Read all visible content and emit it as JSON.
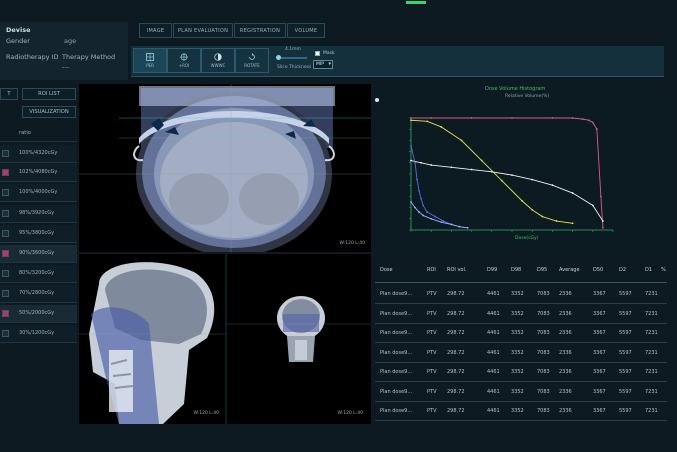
{
  "patient_info": {
    "device_label": "Devise",
    "gender_label": "Gender",
    "age_label": "age",
    "rt_id_label": "Radiotherapy ID",
    "therapy_label": "Therapy Method",
    "therapy_value": "---"
  },
  "tabs": [
    "IMAGE",
    "PLAN EVALUATION",
    "REGISTRATION",
    "VOLUME"
  ],
  "toolbar": {
    "tools": [
      "PER",
      "+ROI",
      "WWWC",
      "ROTATE"
    ],
    "slider_label": "4.1mm",
    "slice_thickness_label": "Slice Thickness",
    "checkbox_label": "Mask",
    "dropdown_value": "MIP"
  },
  "left_panel": {
    "btn_a": "T",
    "btn_roi_list": "ROI LIST",
    "btn_visualization": "VISUALIZATION",
    "header": "ratio",
    "items": [
      {
        "label": "100%/4320cGy",
        "color": "#1a2e38"
      },
      {
        "label": "102%/4080cGy",
        "color": "#c2306a"
      },
      {
        "label": "100%/4000cGy",
        "color": "#1a2e38"
      },
      {
        "label": "98%/3920cGy",
        "color": "#1a2e38"
      },
      {
        "label": "95%/3800cGy",
        "color": "#1a2e38"
      },
      {
        "label": "90%/3600cGy",
        "color": "#c2306a"
      },
      {
        "label": "80%/3200cGy",
        "color": "#1a2e38"
      },
      {
        "label": "70%/2800cGy",
        "color": "#1a2e38"
      },
      {
        "label": "50%/2000cGy",
        "color": "#c2306a"
      },
      {
        "label": "30%/1200cGy",
        "color": "#1a2e38"
      }
    ]
  },
  "views": {
    "axial_wl": "W:120 L:40",
    "sagittal_wl": "W:120 L:40",
    "coronal_wl": "W:120 L:40"
  },
  "chart_data": {
    "type": "line",
    "title": "Dose Volume Histogram",
    "ylabel": "Relative Volume(%)",
    "xlabel": "Dose(cGy)",
    "xlim": [
      0,
      100
    ],
    "ylim": [
      0,
      100
    ],
    "series": [
      {
        "color": "#e05a8a",
        "x": [
          0,
          10,
          30,
          50,
          70,
          80,
          85,
          88,
          90,
          92,
          94,
          95
        ],
        "y": [
          100,
          100,
          100,
          100,
          100,
          100,
          99,
          98,
          96,
          90,
          30,
          2
        ]
      },
      {
        "color": "#e8e050",
        "x": [
          0,
          8,
          15,
          25,
          35,
          45,
          55,
          60,
          65,
          72,
          80
        ],
        "y": [
          98,
          97,
          92,
          80,
          62,
          44,
          26,
          18,
          12,
          8,
          6
        ]
      },
      {
        "color": "#f0f0f0",
        "x": [
          0,
          5,
          10,
          20,
          30,
          40,
          50,
          60,
          70,
          80,
          90,
          95
        ],
        "y": [
          62,
          60,
          58,
          56,
          54,
          52,
          49,
          45,
          40,
          33,
          22,
          8
        ]
      },
      {
        "color": "#5a6be0",
        "x": [
          0,
          2,
          3,
          4,
          5,
          6,
          8,
          12,
          16,
          20,
          24,
          28
        ],
        "y": [
          75,
          60,
          45,
          35,
          28,
          22,
          16,
          12,
          8,
          5,
          3,
          2
        ]
      },
      {
        "color": "#9ab0ff",
        "x": [
          0,
          2,
          4,
          6,
          10,
          15,
          20,
          24,
          28
        ],
        "y": [
          25,
          20,
          16,
          13,
          10,
          7,
          5,
          3,
          2
        ]
      }
    ]
  },
  "table": {
    "headers": [
      "Dose",
      "ROI",
      "ROI vol.",
      "D99",
      "D98",
      "D95",
      "Average",
      "D50",
      "D2",
      "D1",
      "%"
    ],
    "rows": [
      [
        "Plan dose9...",
        "PTV",
        "298.72",
        "4461",
        "3352",
        "7083",
        "2336",
        "3367",
        "5597",
        "7231"
      ],
      [
        "Plan dose9...",
        "PTV",
        "298.72",
        "4461",
        "3352",
        "7083",
        "2336",
        "3367",
        "5597",
        "7231"
      ],
      [
        "Plan dose9...",
        "PTV",
        "298.72",
        "4461",
        "3352",
        "7083",
        "2336",
        "3367",
        "5597",
        "7231"
      ],
      [
        "Plan dose9...",
        "PTV",
        "298.72",
        "4461",
        "3352",
        "7083",
        "2336",
        "3367",
        "5597",
        "7231"
      ],
      [
        "Plan dose9...",
        "PTV",
        "298.72",
        "4461",
        "3352",
        "7083",
        "2336",
        "3367",
        "5597",
        "7231"
      ],
      [
        "Plan dose9...",
        "PTV",
        "298.72",
        "4461",
        "3352",
        "7083",
        "2336",
        "3367",
        "5597",
        "7231"
      ],
      [
        "Plan dose9...",
        "PTV",
        "298.72",
        "4461",
        "3352",
        "7083",
        "2336",
        "3367",
        "5597",
        "7231"
      ]
    ]
  },
  "colors": {
    "accent": "#2d8fb3",
    "dose_high": "#c2306a"
  }
}
